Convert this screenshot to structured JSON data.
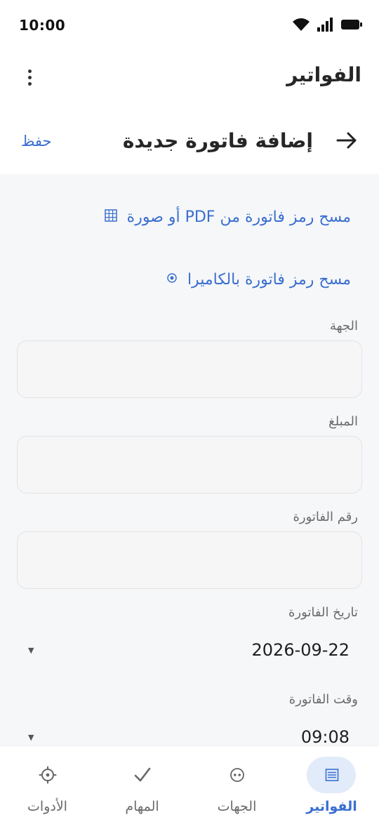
{
  "status_bar": {
    "time": "10:00"
  },
  "app_bar": {
    "title": "الفواتير"
  },
  "form_header": {
    "title": "إضافة فاتورة جديدة",
    "save_label": "حفظ"
  },
  "scan_options": [
    {
      "label": "مسح رمز فاتورة من PDF أو صورة",
      "icon": "grid-scan-icon"
    },
    {
      "label": "مسح رمز فاتورة بالكاميرا",
      "icon": "camera-scan-icon"
    }
  ],
  "fields": {
    "entity": {
      "label": "الجهة",
      "value": ""
    },
    "amount": {
      "label": "المبلغ",
      "value": ""
    },
    "invoice_number": {
      "label": "رقم الفاتورة",
      "value": ""
    },
    "invoice_date": {
      "label": "تاريخ الفاتورة",
      "value": "2026-09-22"
    },
    "invoice_time": {
      "label": "وقت الفاتورة",
      "value": "09:08"
    }
  },
  "bottom_nav": [
    {
      "label": "الفواتير",
      "icon": "invoices-icon",
      "active": true
    },
    {
      "label": "الجهات",
      "icon": "entities-icon",
      "active": false
    },
    {
      "label": "المهام",
      "icon": "tasks-check-icon",
      "active": false
    },
    {
      "label": "الأدوات",
      "icon": "tools-gear-icon",
      "active": false
    }
  ],
  "colors": {
    "accent": "#3a6fd0",
    "background": "#f6f7f9",
    "nav_active_pill": "#e2ebf9"
  }
}
